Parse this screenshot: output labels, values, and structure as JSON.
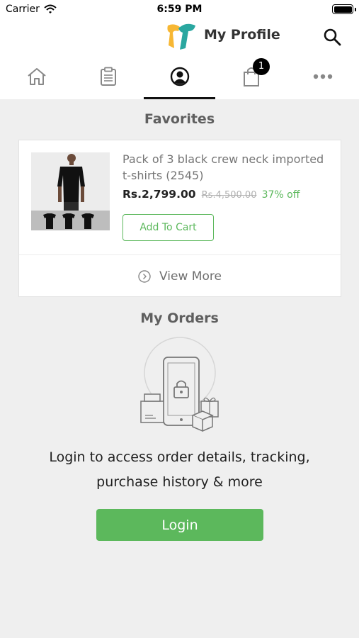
{
  "status_bar": {
    "carrier": "Carrier",
    "time": "6:59 PM"
  },
  "header": {
    "title": "My Profile"
  },
  "tabs": [
    {
      "name": "home",
      "icon": "home-icon"
    },
    {
      "name": "orders",
      "icon": "clipboard-icon"
    },
    {
      "name": "profile",
      "icon": "user-circle-icon",
      "active": true
    },
    {
      "name": "cart",
      "icon": "shopping-bag-icon",
      "badge": "1"
    },
    {
      "name": "more",
      "icon": "more-dots-icon"
    }
  ],
  "favorites": {
    "title": "Favorites",
    "product": {
      "name": "Pack of 3 black crew neck imported t-shirts (2545)",
      "price": "Rs.2,799.00",
      "original_price": "Rs.4,500.00",
      "discount": "37% off",
      "add_to_cart_label": "Add To Cart"
    },
    "view_more_label": "View More"
  },
  "orders": {
    "title": "My Orders",
    "message_line1": "Login to access order details, tracking,",
    "message_line2": "purchase history & more",
    "login_label": "Login"
  },
  "colors": {
    "accent_green": "#5cb85c",
    "badge": "#000000",
    "background": "#efefef"
  }
}
